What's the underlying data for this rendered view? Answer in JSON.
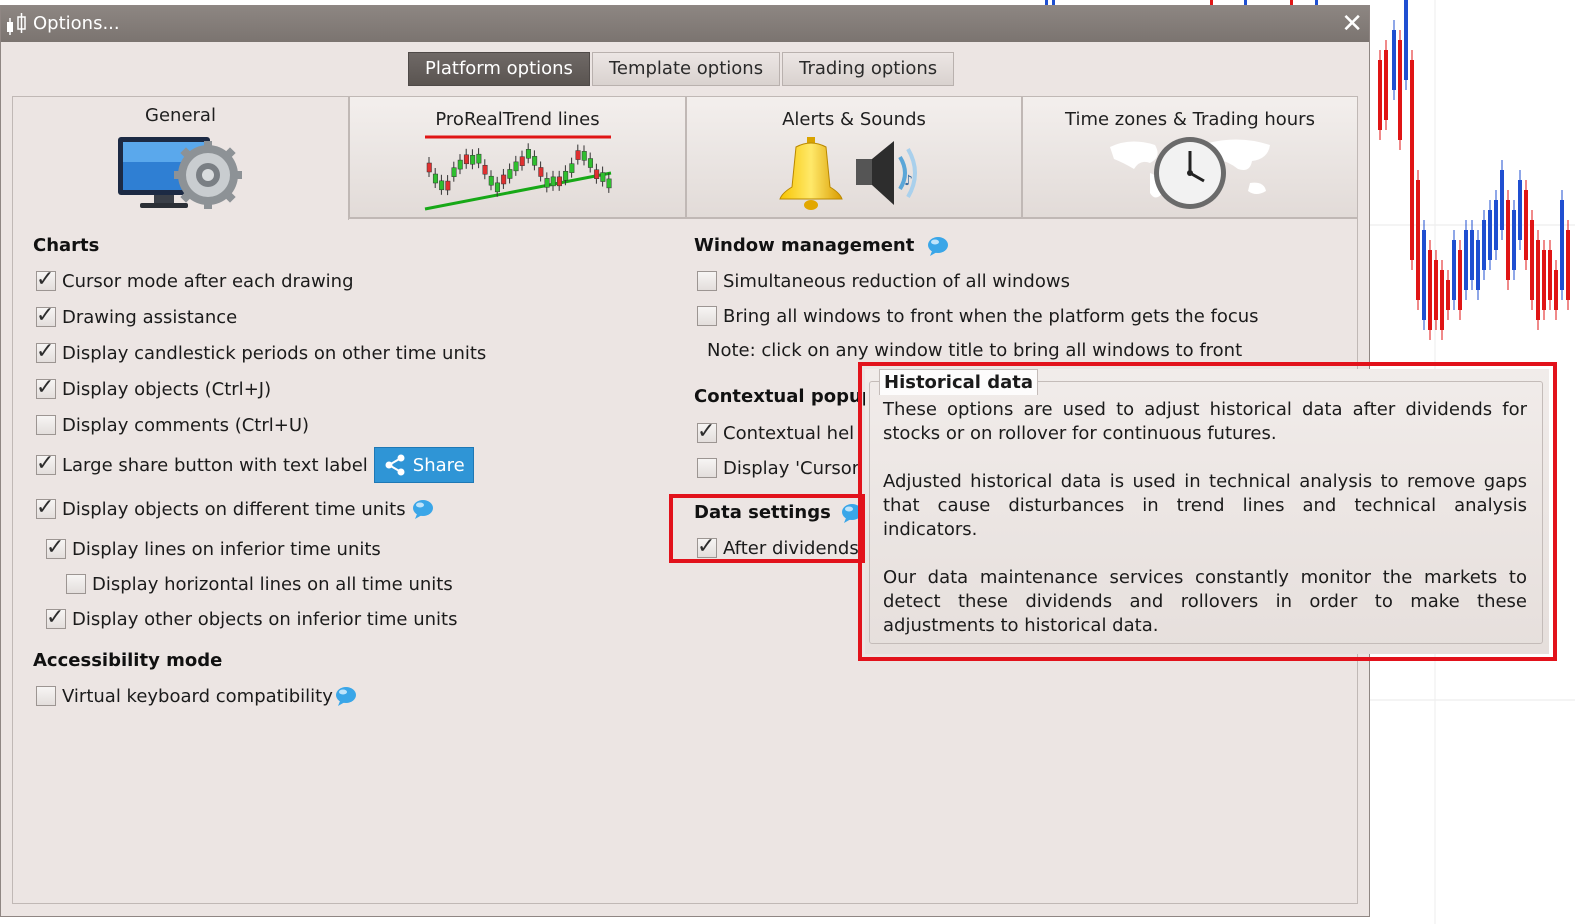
{
  "window": {
    "title": "Options...",
    "close": "✕"
  },
  "top_tabs": [
    "Platform options",
    "Template options",
    "Trading options"
  ],
  "category_tabs": [
    {
      "label": "General",
      "icon": "monitor-gear-icon"
    },
    {
      "label": "ProRealTrend lines",
      "icon": "candlestick-trend-icon"
    },
    {
      "label": "Alerts & Sounds",
      "icon": "bell-speaker-icon"
    },
    {
      "label": "Time zones & Trading hours",
      "icon": "world-clock-icon"
    }
  ],
  "charts": {
    "heading": "Charts",
    "items": [
      {
        "label": "Cursor mode after each drawing",
        "checked": true
      },
      {
        "label": "Drawing assistance",
        "checked": true
      },
      {
        "label": "Display candlestick periods on other time units",
        "checked": true
      },
      {
        "label": "Display objects (Ctrl+J)",
        "checked": true
      },
      {
        "label": "Display comments (Ctrl+U)",
        "checked": false
      },
      {
        "label": "Large share button with text label",
        "checked": true
      },
      {
        "label": "Display objects on different time units",
        "checked": true
      },
      {
        "label": "Display lines on inferior time units",
        "checked": true
      },
      {
        "label": "Display horizontal lines on all time units",
        "checked": false
      },
      {
        "label": "Display other objects on inferior time units",
        "checked": true
      }
    ],
    "share_button": "Share"
  },
  "accessibility": {
    "heading": "Accessibility mode",
    "items": [
      {
        "label": "Virtual keyboard compatibility",
        "checked": false
      }
    ]
  },
  "window_management": {
    "heading": "Window management",
    "items": [
      {
        "label": "Simultaneous reduction of all windows",
        "checked": false
      },
      {
        "label": "Bring all windows to front when the platform gets the focus",
        "checked": false
      }
    ],
    "note": "Note: click on any window title to bring all windows to front"
  },
  "contextual_popups": {
    "heading": "Contextual popup",
    "items": [
      {
        "label": "Contextual hel",
        "checked": true
      },
      {
        "label": "Display 'Cursor",
        "checked": false
      }
    ]
  },
  "data_settings": {
    "heading": "Data settings",
    "items": [
      {
        "label": "After dividends",
        "checked": true
      }
    ]
  },
  "tooltip": {
    "title": "Historical data",
    "paragraphs": [
      "These options are used to adjust historical data after dividends for stocks or on rollover for continuous futures.",
      "Adjusted historical data is used in technical analysis to remove gaps that cause disturbances in trend lines and technical analysis indicators.",
      "Our data maintenance services constantly monitor the markets to detect these dividends and rollovers in order to make these adjustments to historical data."
    ]
  },
  "colors": {
    "highlight_red": "#e2121b",
    "share_blue": "#2f95d6",
    "candle_up": "#1f4fd1",
    "candle_down": "#e01515"
  }
}
